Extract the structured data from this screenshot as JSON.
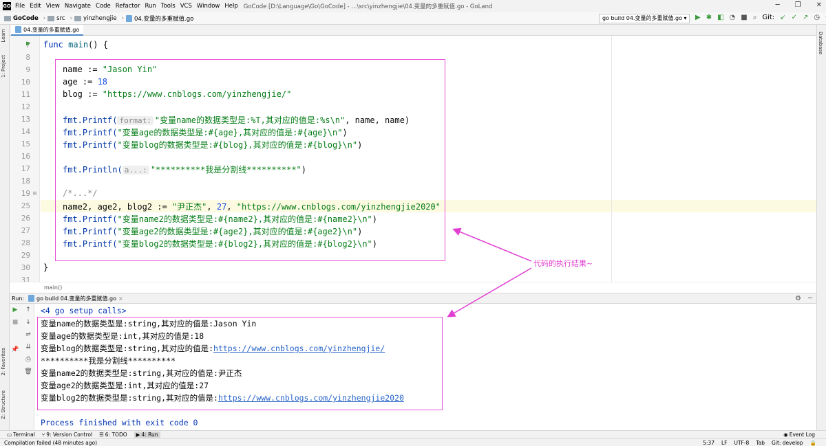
{
  "titlebar": {
    "menu": [
      "File",
      "Edit",
      "View",
      "Navigate",
      "Code",
      "Refactor",
      "Run",
      "Tools",
      "VCS",
      "Window",
      "Help"
    ],
    "window_title": "GoCode [D:\\Language\\Go\\GoCode] - ...\\src\\yinzhengjie\\04.变量的多重赋值.go - GoLand"
  },
  "breadcrumb": {
    "project": "GoCode",
    "src": "src",
    "pkg": "yinzhengjie",
    "file": "04.变量的多重赋值.go"
  },
  "run_config": "go build 04.变量的多重赋值.go",
  "toolbar": {
    "git_label": "Git:"
  },
  "side_left": {
    "learn": "Learn",
    "project": "1: Project",
    "favorites": "2: Favorites",
    "structure": "Z: Structure"
  },
  "side_right": {
    "database": "Database"
  },
  "editor_tab": "04.变量的多重赋值.go",
  "line_numbers": [
    "7",
    "8",
    "9",
    "10",
    "11",
    "12",
    "13",
    "14",
    "15",
    "16",
    "17",
    "18",
    "19",
    "25",
    "26",
    "27",
    "28",
    "29",
    "30",
    "31"
  ],
  "code": {
    "l7": {
      "kw": "func",
      "name": "main",
      "rest": "() {"
    },
    "l9": {
      "lhs": "name := ",
      "val": "\"Jason Yin\""
    },
    "l10": {
      "lhs": "age := ",
      "val": "18"
    },
    "l11": {
      "lhs": "blog := ",
      "val": "\"https://www.cnblogs.com/yinzhengjie/\""
    },
    "l13": {
      "fn": "fmt.Printf(",
      "hint": "format:",
      "str": "\"变量name的数据类型是:%T,其对应的值是:%s\\n\"",
      "rest": ", name, name)"
    },
    "l14": {
      "fn": "fmt.Printf(",
      "str": "\"变量age的数据类型是:#{age},其对应的值是:#{age}\\n\"",
      "rest": ")"
    },
    "l15": {
      "fn": "fmt.Printf(",
      "str": "\"变量blog的数据类型是:#{blog},其对应的值是:#{blog}\\n\"",
      "rest": ")"
    },
    "l17": {
      "fn": "fmt.Println(",
      "hint": "a...:",
      "str": "\"**********我是分割线**********\"",
      "rest": ")"
    },
    "l19": {
      "comment": "/*...*/"
    },
    "l25": {
      "lhs": "name2, age2, blog2 := ",
      "s1": "\"尹正杰\"",
      "sep1": ", ",
      "n": "27",
      "sep2": ", ",
      "s2": "\"https://www.cnblogs.com/yinzhengjie2020\""
    },
    "l26": {
      "fn": "fmt.Printf(",
      "str": "\"变量name2的数据类型是:#{name2},其对应的值是:#{name2}\\n\"",
      "rest": ")"
    },
    "l27": {
      "fn": "fmt.Printf(",
      "str": "\"变量age2的数据类型是:#{age2},其对应的值是:#{age2}\\n\"",
      "rest": ")"
    },
    "l28": {
      "fn": "fmt.Printf(",
      "str": "\"变量blog2的数据类型是:#{blog2},其对应的值是:#{blog2}\\n\"",
      "rest": ")"
    },
    "l30": {
      "text": "}"
    }
  },
  "editor_breadcrumb": "main()",
  "run_panel": {
    "label": "Run:",
    "tab": "go build 04.变量的多重赋值.go"
  },
  "console": {
    "setup": "<4 go setup calls>",
    "lines": [
      "变量name的数据类型是:string,其对应的值是:Jason Yin",
      "变量age的数据类型是:int,其对应的值是:18"
    ],
    "line3_prefix": "变量blog的数据类型是:string,其对应的值是:",
    "line3_url": "https://www.cnblogs.com/yinzhengjie/",
    "line4": "**********我是分割线**********",
    "line5": "变量name2的数据类型是:string,其对应的值是:尹正杰",
    "line6": "变量age2的数据类型是:int,其对应的值是:27",
    "line7_prefix": "变量blog2的数据类型是:string,其对应的值是:",
    "line7_url": "https://www.cnblogs.com/yinzhengjie2020",
    "finish": "Process finished with exit code 0"
  },
  "annotation": "代码的执行结果~",
  "bottom_tabs": [
    "Terminal",
    "9: Version Control",
    "6: TODO",
    "4: Run"
  ],
  "event_log": "Event Log",
  "status": {
    "message": "Compilation failed (48 minutes ago)",
    "position": "5:37",
    "line_sep": "LF",
    "encoding": "UTF-8",
    "indent": "Tab",
    "git": "Git: develop"
  },
  "colors": {
    "annotation": "#e03fd2",
    "box": "#e84ed8"
  }
}
